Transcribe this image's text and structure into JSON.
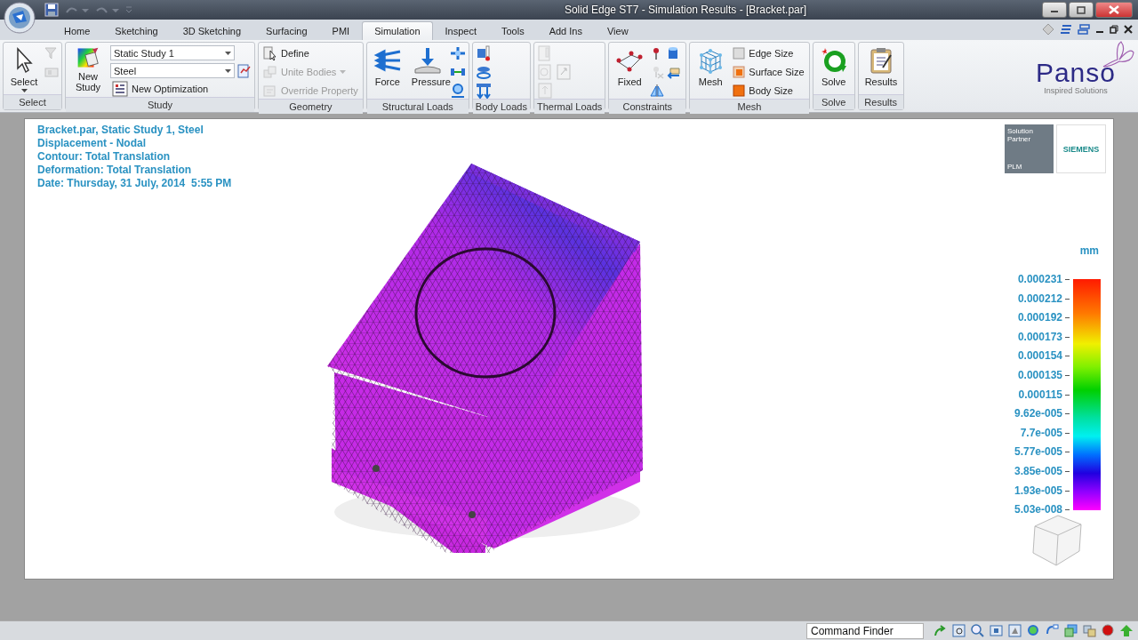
{
  "window": {
    "title": "Solid Edge ST7 - Simulation Results - [Bracket.par]"
  },
  "tabs": [
    {
      "label": "Home",
      "selected": false
    },
    {
      "label": "Sketching",
      "selected": false
    },
    {
      "label": "3D Sketching",
      "selected": false
    },
    {
      "label": "Surfacing",
      "selected": false
    },
    {
      "label": "PMI",
      "selected": false
    },
    {
      "label": "Simulation",
      "selected": true
    },
    {
      "label": "Inspect",
      "selected": false
    },
    {
      "label": "Tools",
      "selected": false
    },
    {
      "label": "Add Ins",
      "selected": false
    },
    {
      "label": "View",
      "selected": false
    }
  ],
  "ribbon": {
    "groups": [
      {
        "label": "Select",
        "columns": [
          [
            {
              "kind": "large",
              "label": "Select",
              "caret": true,
              "disabled": false
            }
          ],
          [
            {
              "kind": "icon",
              "disabled": true
            },
            {
              "kind": "icon",
              "disabled": true
            }
          ]
        ]
      },
      {
        "label": "Study",
        "columns": [
          [
            {
              "kind": "large",
              "label": "New Study",
              "caret": false,
              "disabled": false
            }
          ],
          [
            {
              "kind": "combo",
              "value": "Static Study 1",
              "disabled": false
            },
            {
              "kind": "combo",
              "value": "Steel",
              "disabled": false
            },
            {
              "kind": "small",
              "label": "New Optimization",
              "caret": false,
              "disabled": false
            }
          ],
          [
            {
              "kind": "icon",
              "disabled": false
            }
          ]
        ]
      },
      {
        "label": "Geometry",
        "columns": [
          [
            {
              "kind": "small",
              "label": "Define",
              "caret": false,
              "disabled": false
            },
            {
              "kind": "small",
              "label": "Unite Bodies",
              "caret": true,
              "disabled": true
            },
            {
              "kind": "small",
              "label": "Override Property",
              "caret": false,
              "disabled": true
            }
          ]
        ]
      },
      {
        "label": "Structural Loads",
        "columns": [
          [
            {
              "kind": "large",
              "label": "Force",
              "caret": false,
              "disabled": false
            }
          ],
          [
            {
              "kind": "large",
              "label": "Pressure",
              "caret": false,
              "disabled": false
            }
          ],
          [
            {
              "kind": "icon",
              "disabled": false
            },
            {
              "kind": "icon",
              "disabled": false
            },
            {
              "kind": "icon",
              "disabled": false
            }
          ]
        ]
      },
      {
        "label": "Body Loads",
        "columns": [
          [
            {
              "kind": "icon",
              "disabled": false
            },
            {
              "kind": "icon",
              "disabled": false
            },
            {
              "kind": "icon",
              "disabled": false
            }
          ]
        ]
      },
      {
        "label": "Thermal Loads",
        "columns": [
          [
            {
              "kind": "icon",
              "disabled": true
            },
            {
              "kind": "icon",
              "disabled": true
            },
            {
              "kind": "icon",
              "disabled": true
            }
          ],
          [
            {
              "kind": "icon",
              "disabled": true
            }
          ]
        ]
      },
      {
        "label": "Constraints",
        "columns": [
          [
            {
              "kind": "large",
              "label": "Fixed",
              "caret": false,
              "disabled": false
            }
          ],
          [
            {
              "kind": "icon",
              "disabled": false
            },
            {
              "kind": "icon",
              "disabled": true
            },
            {
              "kind": "icon",
              "disabled": false
            }
          ],
          [
            {
              "kind": "icon",
              "disabled": false
            },
            {
              "kind": "icon",
              "disabled": false
            }
          ]
        ]
      },
      {
        "label": "Mesh",
        "columns": [
          [
            {
              "kind": "large",
              "label": "Mesh",
              "caret": false,
              "disabled": false
            }
          ],
          [
            {
              "kind": "small",
              "label": "Edge Size",
              "caret": false,
              "disabled": false
            },
            {
              "kind": "small",
              "label": "Surface Size",
              "caret": false,
              "disabled": false
            },
            {
              "kind": "small",
              "label": "Body Size",
              "caret": false,
              "disabled": false
            }
          ]
        ]
      },
      {
        "label": "Solve",
        "columns": [
          [
            {
              "kind": "large",
              "label": "Solve",
              "caret": false,
              "disabled": false
            }
          ]
        ]
      },
      {
        "label": "Results",
        "columns": [
          [
            {
              "kind": "large",
              "label": "Results",
              "caret": false,
              "disabled": false
            }
          ]
        ]
      }
    ]
  },
  "logo": {
    "name": "Panso",
    "tagline": "Inspired Solutions"
  },
  "viewport": {
    "info": [
      "Bracket.par, Static Study 1, Steel",
      "Displacement - Nodal",
      "Contour: Total Translation",
      "Deformation: Total Translation",
      "Date: Thursday, 31 July, 2014  5:55 PM"
    ],
    "partner_badge": {
      "line_1": "Solution",
      "line_2": "Partner",
      "line_3": "PLM",
      "brand": "SIEMENS"
    },
    "legend": {
      "unit": "mm",
      "labels": [
        "0.000231",
        "0.000212",
        "0.000192",
        "0.000173",
        "0.000154",
        "0.000135",
        "0.000115",
        "9.62e-005",
        "7.7e-005",
        "5.77e-005",
        "3.85e-005",
        "1.93e-005",
        "5.03e-008"
      ]
    }
  },
  "status_bar": {
    "command_finder": {
      "placeholder": "Command Finder"
    }
  }
}
